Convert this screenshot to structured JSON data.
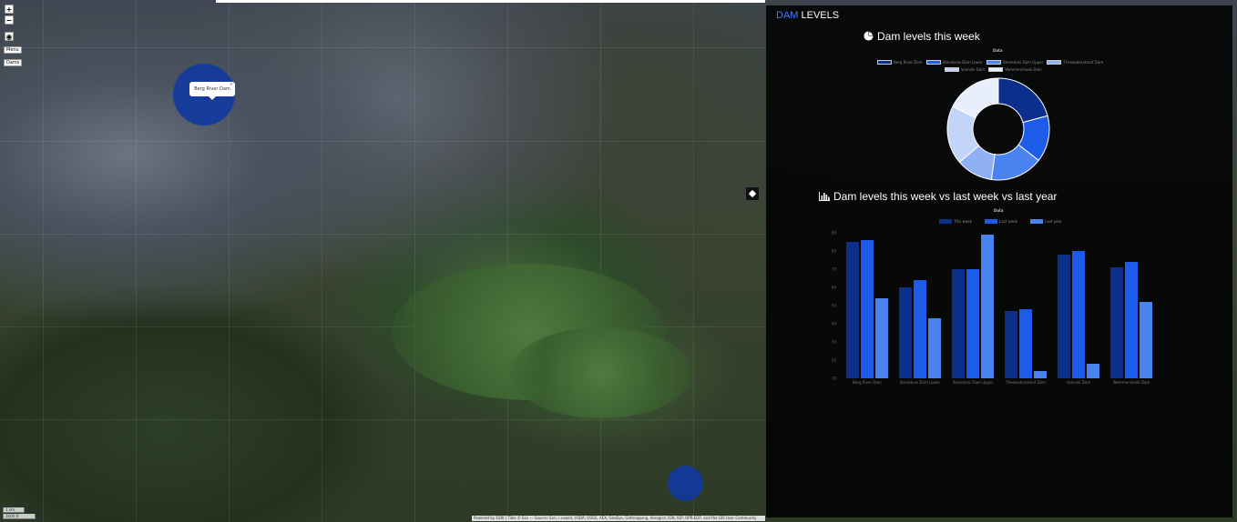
{
  "map": {
    "zoom_in_label": "+",
    "zoom_out_label": "−",
    "locate_label": "◉",
    "menu_label": "Menu",
    "dams_label": "Dams",
    "popup_text": "Berg River Dam",
    "popup_close": "×",
    "scale_km": "1 km",
    "scale_mi": "3000 ft",
    "attribution": "Powered by ESRI | Tiles © Esri — Source: Esri, i-cubed, USDA, USGS, AEX, GeoEye, Getmapping, Aerogrid, IGN, IGP, UPR-EGP, and the GIS User Community",
    "marker_color": "#123a9e"
  },
  "panel": {
    "title_accent": "DAM",
    "title_rest": " LEVELS",
    "accent_color": "#3f7cff",
    "pie_section_title": "Dam levels this week",
    "bar_section_title": "Dam levels this week vs last week vs last year",
    "pie_icon": "pie-chart-icon",
    "bar_icon": "bar-chart-icon"
  },
  "chart_data": [
    {
      "type": "pie",
      "title": "Data",
      "categories": [
        "Berg River Dam",
        "Steenbras Dam Lower",
        "Steenbras Dam Upper",
        "Theewaterskloof Dam",
        "Voelvlei Dam",
        "Wemmershoek Dam"
      ],
      "values": [
        86,
        61,
        69,
        48,
        77,
        73
      ],
      "colors": [
        "#0d2f8c",
        "#1c5ce8",
        "#4a82f0",
        "#8fb0f5",
        "#c2d4f8",
        "#e8eefc"
      ],
      "donut": true,
      "legend": "top"
    },
    {
      "type": "bar",
      "title": "Data",
      "categories": [
        "Berg River Dam",
        "Steenbras Dam Lower",
        "Steenbras Dam Upper",
        "Theewaterskloof Dam",
        "Voelvlei Dam",
        "Wemmershoek Dam"
      ],
      "series": [
        {
          "name": "This week",
          "values": [
            85,
            60,
            70,
            47,
            78,
            71
          ],
          "color": "#0d2f8c"
        },
        {
          "name": "Last week",
          "values": [
            86,
            64,
            70,
            48,
            80,
            74
          ],
          "color": "#1c5ce8"
        },
        {
          "name": "Last year",
          "values": [
            54,
            43,
            89,
            14,
            18,
            52
          ],
          "color": "#4a82f0"
        }
      ],
      "yticks": [
        10,
        20,
        30,
        40,
        50,
        60,
        70,
        80,
        90
      ],
      "ylim": [
        10,
        90
      ],
      "legend": "top",
      "grid": false
    }
  ]
}
